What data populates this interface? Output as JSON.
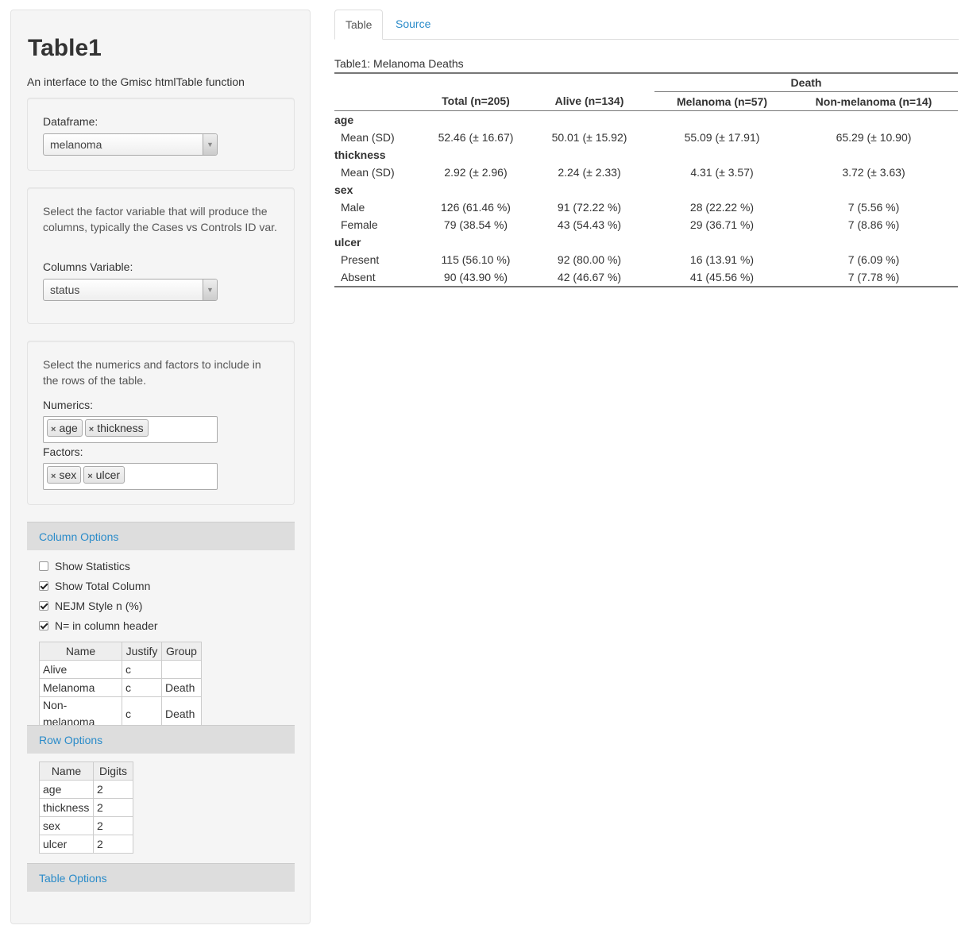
{
  "app": {
    "title": "Table1",
    "subtitle": "An interface to the Gmisc htmlTable function"
  },
  "dataframe": {
    "label": "Dataframe:",
    "value": "melanoma"
  },
  "columns_section": {
    "help": "Select the factor variable that will produce the columns, typically the Cases vs Controls ID var.",
    "label": "Columns Variable:",
    "value": "status"
  },
  "rows_section": {
    "help": "Select the numerics and factors to include in the rows of the table.",
    "numerics_label": "Numerics:",
    "numerics": [
      "age",
      "thickness"
    ],
    "factors_label": "Factors:",
    "factors": [
      "sex",
      "ulcer"
    ]
  },
  "column_options": {
    "heading": "Column Options",
    "checks": [
      {
        "label": "Show Statistics",
        "checked": false
      },
      {
        "label": "Show Total Column",
        "checked": true
      },
      {
        "label": "NEJM Style n (%)",
        "checked": true
      },
      {
        "label": "N= in column header",
        "checked": true
      }
    ],
    "table": {
      "headers": [
        "Name",
        "Justify",
        "Group"
      ],
      "rows": [
        [
          "Alive",
          "c",
          ""
        ],
        [
          "Melanoma",
          "c",
          "Death"
        ],
        [
          "Non-melanoma",
          "c",
          "Death"
        ]
      ]
    }
  },
  "row_options": {
    "heading": "Row Options",
    "table": {
      "headers": [
        "Name",
        "Digits"
      ],
      "rows": [
        [
          "age",
          "2"
        ],
        [
          "thickness",
          "2"
        ],
        [
          "sex",
          "2"
        ],
        [
          "ulcer",
          "2"
        ]
      ]
    }
  },
  "table_options": {
    "heading": "Table Options"
  },
  "tabs": [
    "Table",
    "Source"
  ],
  "result": {
    "caption": "Table1: Melanoma Deaths",
    "group_header": "Death",
    "headers": [
      "Total (n=205)",
      "Alive (n=134)",
      "Melanoma (n=57)",
      "Non-melanoma (n=14)"
    ],
    "groups": [
      {
        "name": "age",
        "rows": [
          {
            "label": "Mean (SD)",
            "values": [
              "52.46 (± 16.67)",
              "50.01 (± 15.92)",
              "55.09 (± 17.91)",
              "65.29 (± 10.90)"
            ]
          }
        ]
      },
      {
        "name": "thickness",
        "rows": [
          {
            "label": "Mean (SD)",
            "values": [
              "2.92 (± 2.96)",
              "2.24 (± 2.33)",
              "4.31 (± 3.57)",
              "3.72 (± 3.63)"
            ]
          }
        ]
      },
      {
        "name": "sex",
        "rows": [
          {
            "label": "Male",
            "values": [
              "126 (61.46 %)",
              "91 (72.22 %)",
              "28 (22.22 %)",
              "7 (5.56 %)"
            ]
          },
          {
            "label": "Female",
            "values": [
              "79 (38.54 %)",
              "43 (54.43 %)",
              "29 (36.71 %)",
              "7 (8.86 %)"
            ]
          }
        ]
      },
      {
        "name": "ulcer",
        "rows": [
          {
            "label": "Present",
            "values": [
              "115 (56.10 %)",
              "92 (80.00 %)",
              "16 (13.91 %)",
              "7 (6.09 %)"
            ]
          },
          {
            "label": "Absent",
            "values": [
              "90 (43.90 %)",
              "42 (46.67 %)",
              "41 (45.56 %)",
              "7 (7.78 %)"
            ]
          }
        ]
      }
    ]
  }
}
